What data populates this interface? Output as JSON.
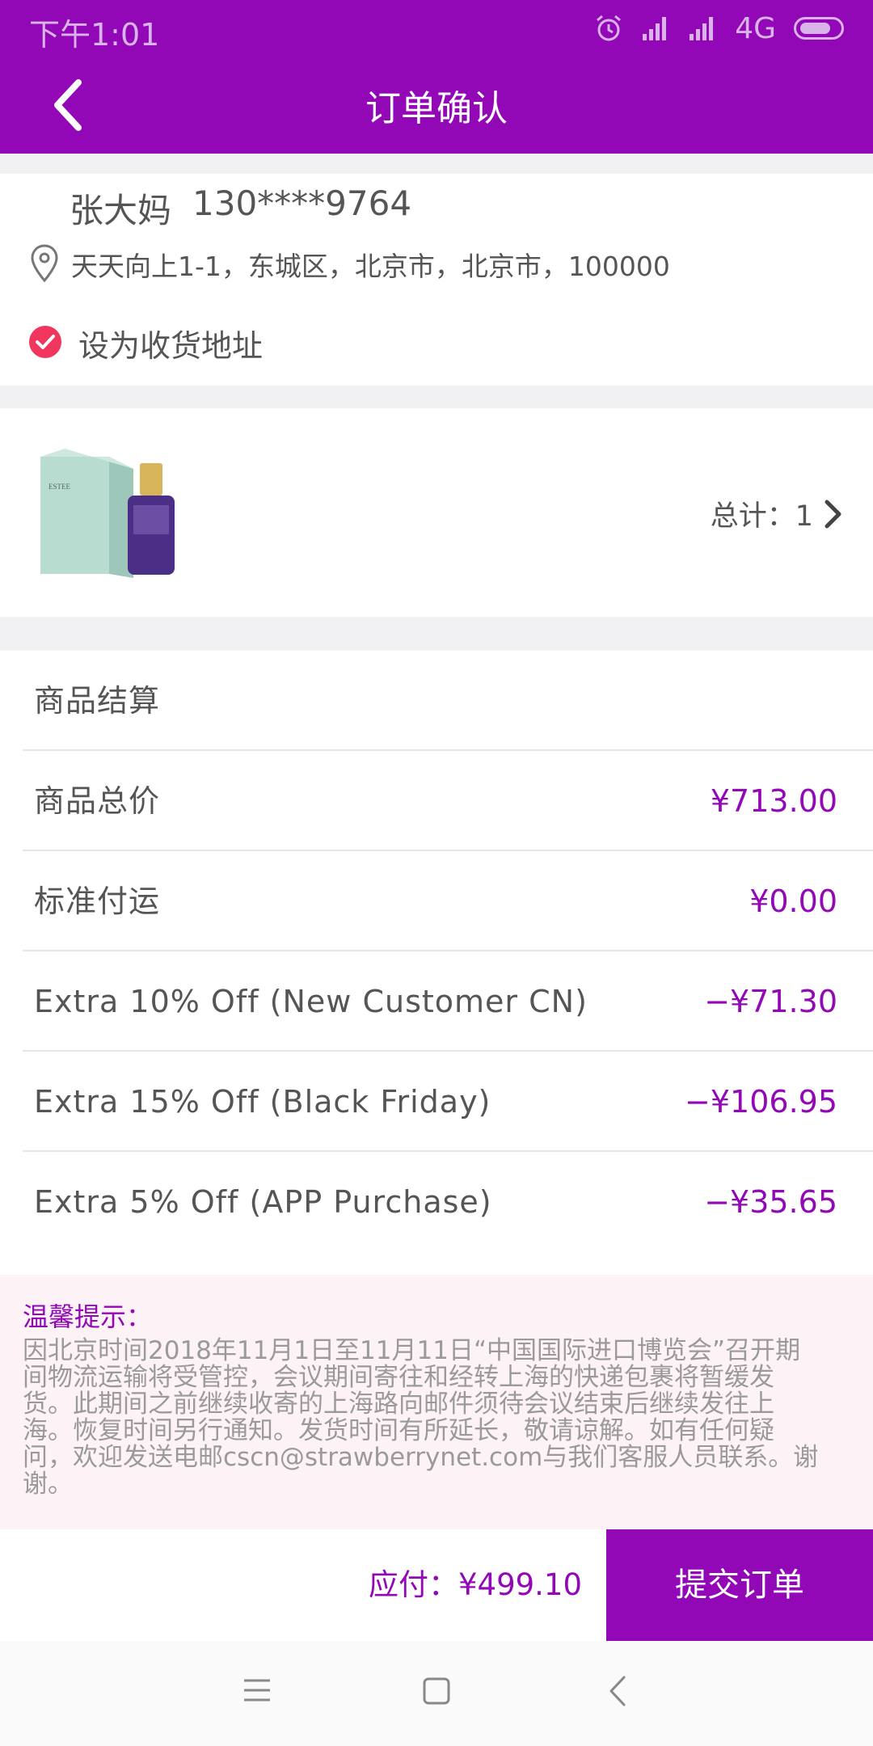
{
  "status_bar": {
    "time": "下午1:01",
    "network": "4G",
    "battery_percent": 80
  },
  "header": {
    "title": "订单确认"
  },
  "address": {
    "name": "张大妈",
    "phone": "130****9764",
    "full_address": "天天向上1-1，东城区，北京市，北京市，100000",
    "default_label": "设为收货地址"
  },
  "product_summary": {
    "total_text": "总计：1"
  },
  "settlement": {
    "title": "商品结算",
    "rows": [
      {
        "label": "商品总价",
        "value": "¥713.00"
      },
      {
        "label": "标准付运",
        "value": "¥0.00"
      },
      {
        "label": "Extra 10% Off (New Customer CN)",
        "value": "−¥71.30"
      },
      {
        "label": "Extra 15% Off (Black Friday)",
        "value": "−¥106.95"
      },
      {
        "label": "Extra 5% Off (APP Purchase)",
        "value": "−¥35.65"
      }
    ]
  },
  "notice": {
    "title": "温馨提示：",
    "body": "因北京时间2018年11月1日至11月11日“中国国际进口博览会”召开期间物流运输将受管控，会议期间寄往和经转上海的快递包裹将暂缓发货。此期间之前继续收寄的上海路向邮件须待会议结束后继续发往上海。恢复时间另行通知。发货时间有所延长，敬请谅解。如有任何疑问，欢迎发送电邮cscn@strawberrynet.com与我们客服人员联系。谢谢。"
  },
  "footer": {
    "payable": "应付：¥499.10",
    "submit_label": "提交订单"
  },
  "colors": {
    "brand": "#9208b6",
    "check": "#f0365d",
    "notice_bg": "#fdf3f6"
  }
}
